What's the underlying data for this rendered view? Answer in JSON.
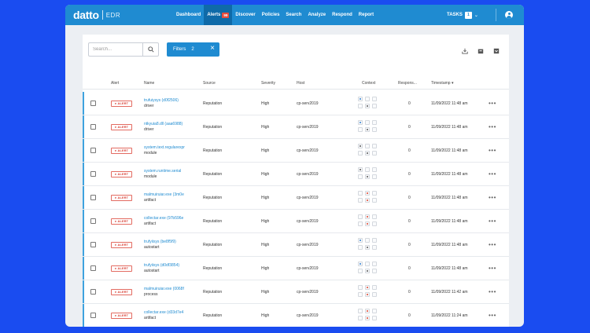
{
  "app": {
    "logo": "datto",
    "logo_sub": "EDR"
  },
  "nav": [
    {
      "label": "Dashboard"
    },
    {
      "label": "Alerts",
      "badge": "99"
    },
    {
      "label": "Discover"
    },
    {
      "label": "Policies"
    },
    {
      "label": "Search"
    },
    {
      "label": "Analyze"
    },
    {
      "label": "Respond"
    },
    {
      "label": "Report"
    }
  ],
  "tasks": {
    "label": "TASKS",
    "count": "1"
  },
  "toolbar": {
    "search_placeholder": "Search...",
    "filters_label": "Filters",
    "filters_count": "2"
  },
  "table": {
    "headers": {
      "alert": "Alert",
      "name": "Name",
      "source": "Source",
      "severity": "Severity",
      "host": "Host",
      "context": "Context",
      "responses": "Respons...",
      "timestamp": "Timestamp"
    },
    "rows": [
      {
        "badge": "ALERT",
        "name": "trufuiysys (d0f2506)",
        "type": "driver",
        "source": "Reputation",
        "severity": "High",
        "host": "cp-serv2019",
        "responses": "0",
        "timestamp": "11/09/2022 11:48 am",
        "ctx_color": "#2f7fd0"
      },
      {
        "badge": "ALERT",
        "name": "ntkyuia8.dll (aaa6988)",
        "type": "driver",
        "source": "Reputation",
        "severity": "High",
        "host": "cp-serv2019",
        "responses": "0",
        "timestamp": "11/09/2022 11:48 am",
        "ctx_color": "#2f7fd0"
      },
      {
        "badge": "ALERT",
        "name": "system.text.regularexpr",
        "type": "module",
        "source": "Reputation",
        "severity": "High",
        "host": "cp-serv2019",
        "responses": "0",
        "timestamp": "11/09/2022 11:48 am",
        "ctx_color": "#555555"
      },
      {
        "badge": "ALERT",
        "name": "system.runtime.serial",
        "type": "module",
        "source": "Reputation",
        "severity": "High",
        "host": "cp-serv2019",
        "responses": "0",
        "timestamp": "11/09/2022 11:48 am",
        "ctx_color": "#555555"
      },
      {
        "badge": "ALERT",
        "name": "malmuiruiar.exe (3m0e",
        "type": "artifact",
        "source": "Reputation",
        "severity": "High",
        "host": "cp-serv2019",
        "responses": "0",
        "timestamp": "11/09/2022 11:48 am",
        "ctx_color": "#e0452f"
      },
      {
        "badge": "ALERT",
        "name": "collectar.exe (97b596e",
        "type": "artifact",
        "source": "Reputation",
        "severity": "High",
        "host": "cp-serv2019",
        "responses": "0",
        "timestamp": "11/09/2022 11:48 am",
        "ctx_color": "#e0452f"
      },
      {
        "badge": "ALERT",
        "name": "trufyiisys (be8f5f9)",
        "type": "autostart",
        "source": "Reputation",
        "severity": "High",
        "host": "cp-serv2019",
        "responses": "0",
        "timestamp": "11/09/2022 11:48 am",
        "ctx_color": "#2f7fd0"
      },
      {
        "badge": "ALERT",
        "name": "trufyiisys (d0df3854)",
        "type": "autostart",
        "source": "Reputation",
        "severity": "High",
        "host": "cp-serv2019",
        "responses": "0",
        "timestamp": "11/09/2022 11:48 am",
        "ctx_color": "#2f7fd0"
      },
      {
        "badge": "ALERT",
        "name": "malmuiruiar.exe (0068f",
        "type": "process",
        "source": "Reputation",
        "severity": "High",
        "host": "cp-serv2019",
        "responses": "0",
        "timestamp": "11/09/2022 11:42 am",
        "ctx_color": "#e0452f"
      },
      {
        "badge": "ALERT",
        "name": "collectar.exe (d33d7e4",
        "type": "artifact",
        "source": "Reputation",
        "severity": "High",
        "host": "cp-serv2019",
        "responses": "0",
        "timestamp": "11/09/2022 11:24 am",
        "ctx_color": "#e0452f"
      }
    ]
  }
}
